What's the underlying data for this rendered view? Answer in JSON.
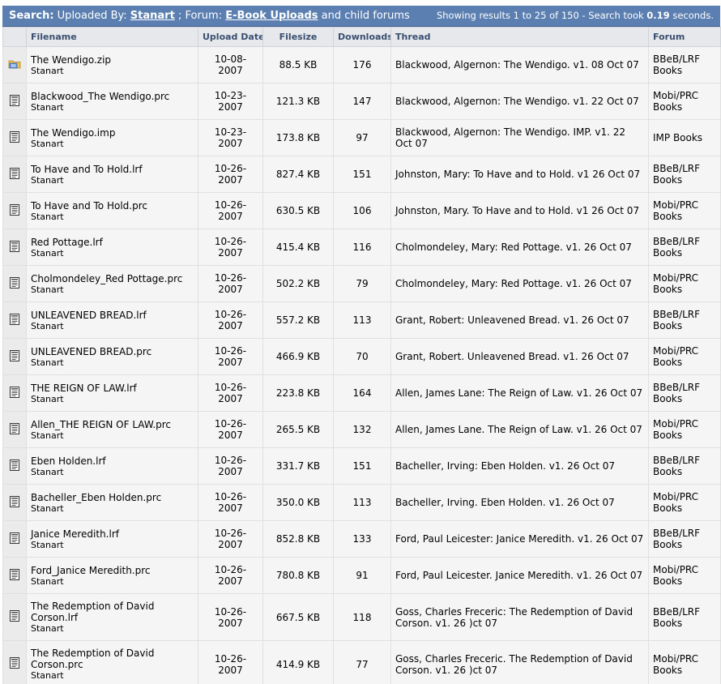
{
  "header": {
    "search_label": "Search:",
    "uploaded_by_label": "Uploaded By:",
    "uploader": "Stanart",
    "separator": ";",
    "forum_label": "Forum:",
    "forum_name": "E-Book Uploads",
    "child_forums": "and child forums",
    "results_prefix": "Showing results 1 to 25 of 150 - Search took",
    "search_time": "0.19",
    "results_suffix": "seconds."
  },
  "columns": {
    "filename": "Filename",
    "upload_date": "Upload Date",
    "filesize": "Filesize",
    "downloads": "Downloads",
    "thread": "Thread",
    "forum": "Forum"
  },
  "rows": [
    {
      "icon": "zip-archive-icon",
      "filename": "The Wendigo.zip",
      "uploader": "Stanart",
      "date": "10-08-2007",
      "size": "88.5 KB",
      "downloads": "176",
      "thread": "Blackwood, Algernon: The Wendigo. v1. 08 Oct 07",
      "forum": "BBeB/LRF Books"
    },
    {
      "icon": "document-icon",
      "filename": "Blackwood_The Wendigo.prc",
      "uploader": "Stanart",
      "date": "10-23-2007",
      "size": "121.3 KB",
      "downloads": "147",
      "thread": "Blackwood, Algernon: The Wendigo. v1. 22 Oct 07",
      "forum": "Mobi/PRC Books"
    },
    {
      "icon": "document-icon",
      "filename": "The Wendigo.imp",
      "uploader": "Stanart",
      "date": "10-23-2007",
      "size": "173.8 KB",
      "downloads": "97",
      "thread": "Blackwood, Algernon: The Wendigo. IMP. v1. 22 Oct 07",
      "forum": "IMP Books"
    },
    {
      "icon": "document-icon",
      "filename": "To Have and To Hold.lrf",
      "uploader": "Stanart",
      "date": "10-26-2007",
      "size": "827.4 KB",
      "downloads": "151",
      "thread": "Johnston, Mary: To Have and to Hold. v1 26 Oct 07",
      "forum": "BBeB/LRF Books"
    },
    {
      "icon": "document-icon",
      "filename": "To Have and To Hold.prc",
      "uploader": "Stanart",
      "date": "10-26-2007",
      "size": "630.5 KB",
      "downloads": "106",
      "thread": "Johnston, Mary. To Have and to Hold. v1 26 Oct 07",
      "forum": "Mobi/PRC Books"
    },
    {
      "icon": "document-icon",
      "filename": "Red Pottage.lrf",
      "uploader": "Stanart",
      "date": "10-26-2007",
      "size": "415.4 KB",
      "downloads": "116",
      "thread": "Cholmondeley, Mary: Red Pottage. v1. 26 Oct 07",
      "forum": "BBeB/LRF Books"
    },
    {
      "icon": "document-icon",
      "filename": "Cholmondeley_Red Pottage.prc",
      "uploader": "Stanart",
      "date": "10-26-2007",
      "size": "502.2 KB",
      "downloads": "79",
      "thread": "Cholmondeley, Mary: Red Pottage. v1. 26 Oct 07",
      "forum": "Mobi/PRC Books"
    },
    {
      "icon": "document-icon",
      "filename": "UNLEAVENED BREAD.lrf",
      "uploader": "Stanart",
      "date": "10-26-2007",
      "size": "557.2 KB",
      "downloads": "113",
      "thread": "Grant, Robert: Unleavened Bread. v1. 26 Oct 07",
      "forum": "BBeB/LRF Books"
    },
    {
      "icon": "document-icon",
      "filename": "UNLEAVENED BREAD.prc",
      "uploader": "Stanart",
      "date": "10-26-2007",
      "size": "466.9 KB",
      "downloads": "70",
      "thread": "Grant, Robert. Unleavened Bread. v1. 26 Oct 07",
      "forum": "Mobi/PRC Books"
    },
    {
      "icon": "document-icon",
      "filename": "THE REIGN OF LAW.lrf",
      "uploader": "Stanart",
      "date": "10-26-2007",
      "size": "223.8 KB",
      "downloads": "164",
      "thread": "Allen, James Lane: The Reign of Law. v1. 26 Oct 07",
      "forum": "BBeB/LRF Books"
    },
    {
      "icon": "document-icon",
      "filename": "Allen_THE REIGN OF LAW.prc",
      "uploader": "Stanart",
      "date": "10-26-2007",
      "size": "265.5 KB",
      "downloads": "132",
      "thread": "Allen, James Lane. The Reign of Law. v1. 26 Oct 07",
      "forum": "Mobi/PRC Books"
    },
    {
      "icon": "document-icon",
      "filename": "Eben Holden.lrf",
      "uploader": "Stanart",
      "date": "10-26-2007",
      "size": "331.7 KB",
      "downloads": "151",
      "thread": "Bacheller, Irving: Eben Holden. v1. 26 Oct 07",
      "forum": "BBeB/LRF Books"
    },
    {
      "icon": "document-icon",
      "filename": "Bacheller_Eben Holden.prc",
      "uploader": "Stanart",
      "date": "10-26-2007",
      "size": "350.0 KB",
      "downloads": "113",
      "thread": "Bacheller, Irving. Eben Holden. v1. 26 Oct 07",
      "forum": "Mobi/PRC Books"
    },
    {
      "icon": "document-icon",
      "filename": "Janice Meredith.lrf",
      "uploader": "Stanart",
      "date": "10-26-2007",
      "size": "852.8 KB",
      "downloads": "133",
      "thread": "Ford, Paul Leicester: Janice Meredith. v1. 26 Oct 07",
      "forum": "BBeB/LRF Books"
    },
    {
      "icon": "document-icon",
      "filename": "Ford_Janice Meredith.prc",
      "uploader": "Stanart",
      "date": "10-26-2007",
      "size": "780.8 KB",
      "downloads": "91",
      "thread": "Ford, Paul Leicester. Janice Meredith. v1. 26 Oct 07",
      "forum": "Mobi/PRC Books"
    },
    {
      "icon": "document-icon",
      "filename": "The Redemption of David Corson.lrf",
      "uploader": "Stanart",
      "date": "10-26-2007",
      "size": "667.5 KB",
      "downloads": "118",
      "thread": "Goss, Charles Freceric: The Redemption of David Corson. v1. 26 )ct 07",
      "forum": "BBeB/LRF Books"
    },
    {
      "icon": "document-icon",
      "filename": "The Redemption of David Corson.prc",
      "uploader": "Stanart",
      "date": "10-26-2007",
      "size": "414.9 KB",
      "downloads": "77",
      "thread": "Goss, Charles Freceric. The Redemption of David Corson. v1. 26 )ct 07",
      "forum": "Mobi/PRC Books"
    }
  ]
}
